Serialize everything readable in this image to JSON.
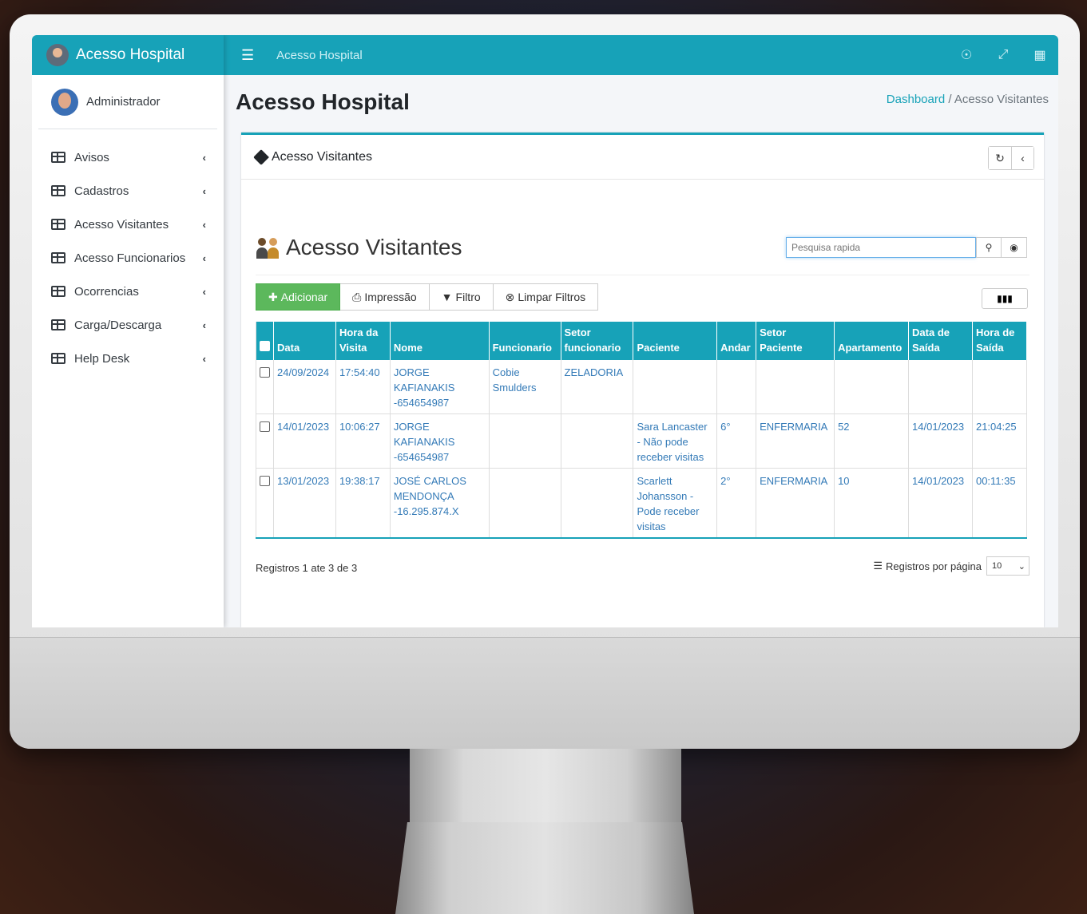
{
  "sidebar": {
    "brand": "Acesso Hospital",
    "user_name": "Administrador",
    "items": [
      {
        "label": "Avisos"
      },
      {
        "label": "Cadastros"
      },
      {
        "label": "Acesso Visitantes"
      },
      {
        "label": "Acesso Funcionarios"
      },
      {
        "label": "Ocorrencias"
      },
      {
        "label": "Carga/Descarga"
      },
      {
        "label": "Help Desk"
      }
    ]
  },
  "topbar": {
    "title": "Acesso Hospital"
  },
  "page": {
    "title": "Acesso Hospital",
    "breadcrumb_link": "Dashboard",
    "breadcrumb_sep": "/",
    "breadcrumb_current": "Acesso Visitantes"
  },
  "card": {
    "header": "Acesso Visitantes"
  },
  "list": {
    "title": "Acesso Visitantes",
    "search_placeholder": "Pesquisa rapida",
    "buttons": {
      "add": "Adicionar",
      "print": "Impressão",
      "filter": "Filtro",
      "clear": "Limpar Filtros"
    },
    "columns": [
      "Data",
      "Hora da Visita",
      "Nome",
      "Funcionario",
      "Setor funcionario",
      "Paciente",
      "Andar",
      "Setor Paciente",
      "Apartamento",
      "Data de Saída",
      "Hora de Saída"
    ],
    "rows": [
      [
        "24/09/2024",
        "17:54:40",
        "JORGE KAFIANAKIS -654654987",
        "Cobie Smulders",
        "ZELADORIA",
        "",
        "",
        "",
        "",
        "",
        ""
      ],
      [
        "14/01/2023",
        "10:06:27",
        "JORGE KAFIANAKIS -654654987",
        "",
        "",
        "Sara Lancaster - Não pode receber visitas",
        "6°",
        "ENFERMARIA",
        "52",
        "14/01/2023",
        "21:04:25"
      ],
      [
        "13/01/2023",
        "19:38:17",
        "JOSÉ CARLOS MENDONÇA -16.295.874.X",
        "",
        "",
        "Scarlett Johansson - Pode receber visitas",
        "2°",
        "ENFERMARIA",
        "10",
        "14/01/2023",
        "00:11:35"
      ]
    ],
    "records_info": "Registros 1 ate 3 de 3",
    "per_page_label": "Registros por página",
    "per_page_value": "10"
  },
  "colors": {
    "accent": "#17a2b8",
    "success": "#5cb85c",
    "link": "#337ab7"
  }
}
